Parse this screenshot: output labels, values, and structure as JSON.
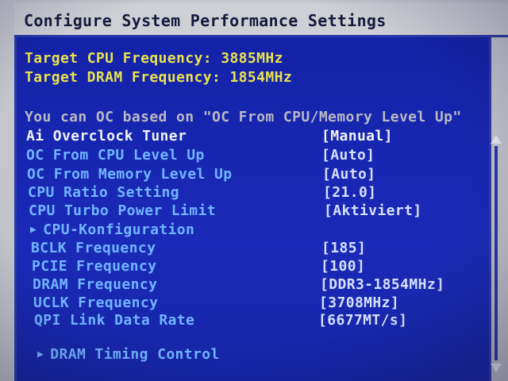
{
  "header": {
    "title": "Configure System Performance Settings"
  },
  "targets": {
    "cpu_frequency": "Target CPU Frequency: 3885MHz",
    "dram_frequency": "Target DRAM Frequency: 1854MHz"
  },
  "hint": "You can OC based on \"OC From CPU/Memory Level Up\"",
  "settings": [
    {
      "label": "Ai Overclock Tuner",
      "value": "[Manual]"
    },
    {
      "label": "OC From CPU Level Up",
      "value": "[Auto]"
    },
    {
      "label": "OC From Memory Level Up",
      "value": "[Auto]"
    },
    {
      "label": "CPU Ratio Setting",
      "value": "[21.0]"
    },
    {
      "label": "CPU Turbo Power Limit",
      "value": "[Aktiviert]"
    }
  ],
  "submenu_cpu": "CPU-Konfiguration",
  "frequencies": [
    {
      "label": "BCLK Frequency",
      "value": "[185]"
    },
    {
      "label": "PCIE Frequency",
      "value": "[100]"
    },
    {
      "label": "DRAM Frequency",
      "value": "[DDR3-1854MHz]"
    },
    {
      "label": "UCLK Frequency",
      "value": "[3708MHz]"
    },
    {
      "label": "QPI Link Data Rate",
      "value": "[6677MT/s]"
    }
  ],
  "submenu_dram": "DRAM Timing Control",
  "colors": {
    "panel_blue": "#1a2ab8",
    "frame_blue": "#2a3aa8",
    "highlight_yellow": "#e9e34c",
    "item_blue": "#72b5ff"
  },
  "icons": {
    "submenu_arrow": "triangle-right-icon",
    "scroll_up": "arrow-up-icon",
    "scroll_down": "arrow-down-icon"
  }
}
